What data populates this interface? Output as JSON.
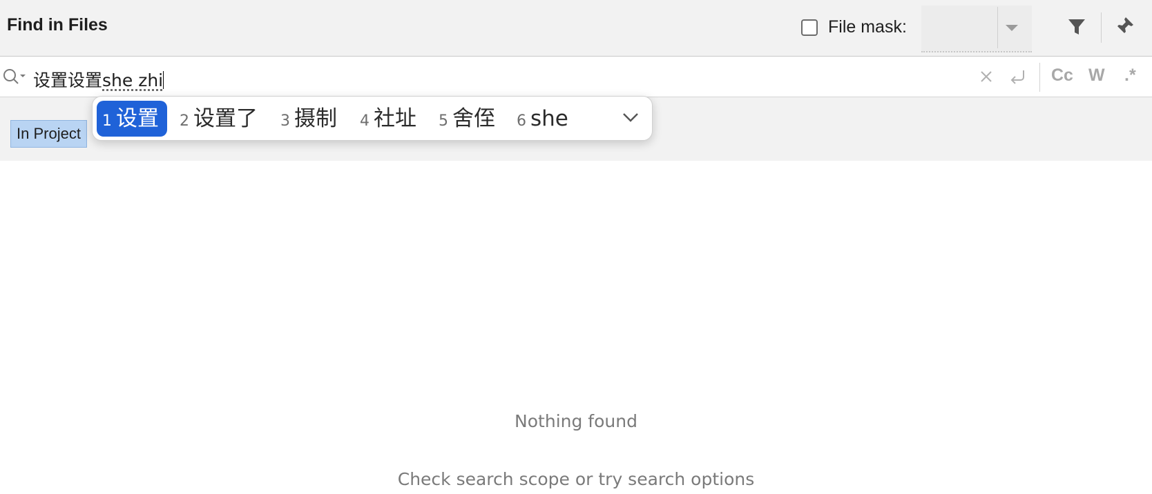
{
  "header": {
    "title": "Find in Files",
    "file_mask_label": "File mask:",
    "file_mask_checked": false,
    "file_mask_value": ""
  },
  "search": {
    "committed_text": "设置设置",
    "composing_text": "she zhi"
  },
  "options": {
    "match_case": "Cc",
    "words": "W",
    "regex": ".*"
  },
  "scope": {
    "selected": "In Project"
  },
  "ime": {
    "candidates": [
      {
        "num": "1",
        "text": "设置"
      },
      {
        "num": "2",
        "text": "设置了"
      },
      {
        "num": "3",
        "text": "摄制"
      },
      {
        "num": "4",
        "text": "社址"
      },
      {
        "num": "5",
        "text": "舍侄"
      },
      {
        "num": "6",
        "text": "she"
      }
    ],
    "selected_index": 0
  },
  "results": {
    "empty_title": "Nothing found",
    "empty_hint": "Check search scope or try search options"
  },
  "colors": {
    "accent": "#1f62d8",
    "scope_selected_bg": "#b9d4f3",
    "toolbar_bg": "#f2f2f2"
  }
}
